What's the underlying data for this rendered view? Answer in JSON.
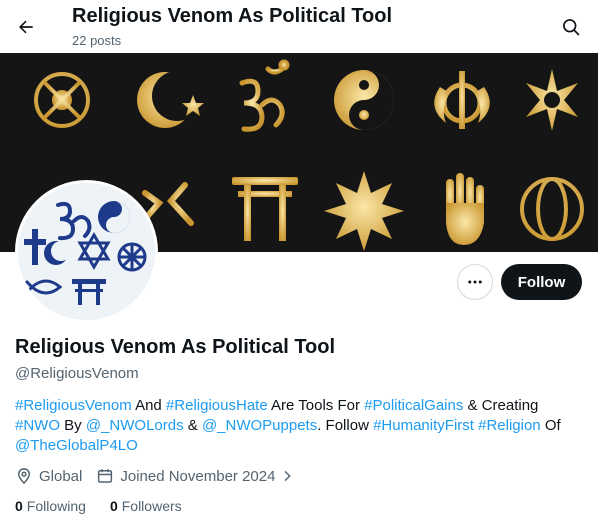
{
  "header": {
    "title": "Religious Venom As Political Tool",
    "subtitle": "22 posts"
  },
  "profile": {
    "name": "Religious Venom As Political Tool",
    "handle": "@ReligiousVenom",
    "follow_label": "Follow"
  },
  "bio": {
    "t1": "#ReligiousVenom",
    "t2": " And ",
    "t3": "#ReligiousHate",
    "t4": " Are Tools For ",
    "t5": "#PoliticalGains",
    "t6": " & Creating ",
    "t7": "#NWO",
    "t8": " By ",
    "t9": "@_NWOLords",
    "t10": " & ",
    "t11": "@_NWOPuppets",
    "t12": ". Follow ",
    "t13": "#HumanityFirst",
    "t14": " ",
    "t15": "#Religion",
    "t16": " Of ",
    "t17": "@TheGlobalP4LO"
  },
  "meta": {
    "location": "Global",
    "joined": "Joined November 2024"
  },
  "stats": {
    "following_count": "0",
    "following_label": "Following",
    "followers_count": "0",
    "followers_label": "Followers"
  },
  "icons": {
    "back": "arrow-left-icon",
    "search": "search-icon",
    "more": "more-horizontal-icon",
    "location": "location-pin-icon",
    "calendar": "calendar-icon",
    "chevron": "chevron-right-icon"
  },
  "colors": {
    "link": "#1d9bf0",
    "text": "#0f1419",
    "muted": "#536471",
    "follow_bg": "#0f1419",
    "banner_bg": "#151515",
    "symbol_gold": "#e9c46a"
  }
}
